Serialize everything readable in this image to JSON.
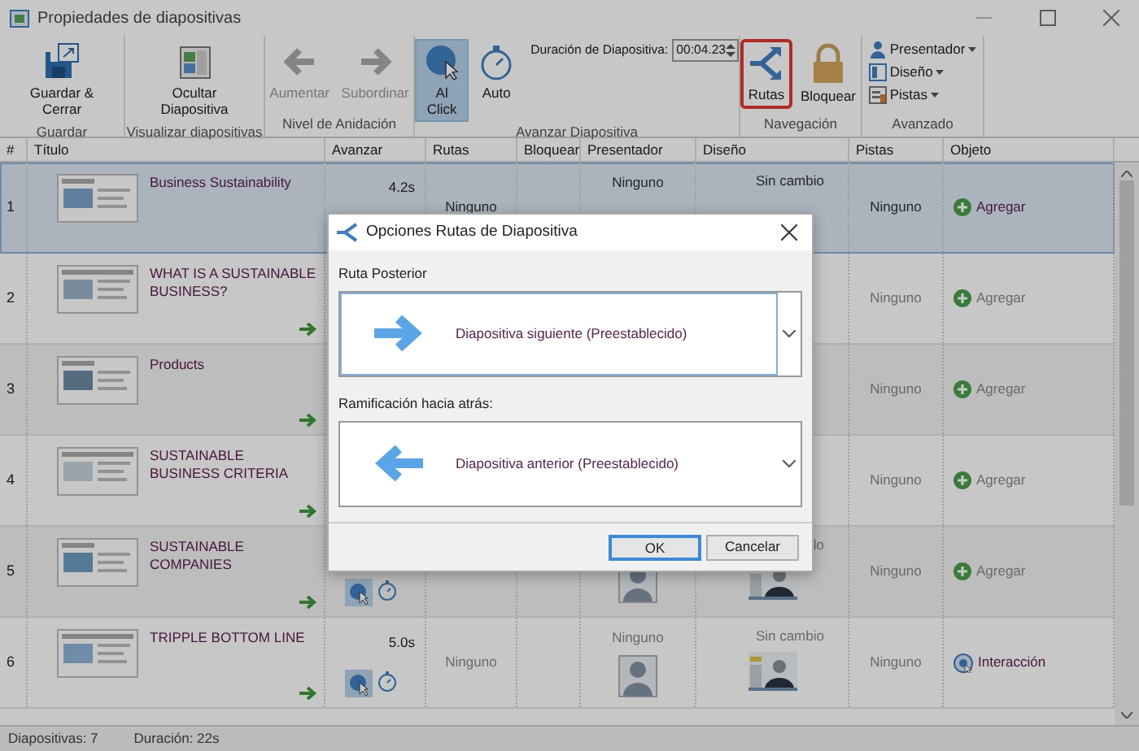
{
  "window": {
    "title": "Propiedades de diapositivas"
  },
  "ribbon": {
    "groups": [
      {
        "label": "Guardar",
        "items": [
          {
            "kind": "button",
            "label": "Guardar & Cerrar",
            "disabled": false,
            "selected": false,
            "highlighted": false
          }
        ]
      },
      {
        "label": "Visualizar diapositivas",
        "items": [
          {
            "kind": "button",
            "label": "Ocultar Diapositiva",
            "disabled": false,
            "selected": false,
            "highlighted": false
          }
        ]
      },
      {
        "label": "Nivel de Anidación",
        "items": [
          {
            "kind": "button",
            "label": "Aumentar",
            "disabled": true,
            "selected": false,
            "highlighted": false
          },
          {
            "kind": "button",
            "label": "Subordinar",
            "disabled": true,
            "selected": false,
            "highlighted": false
          }
        ]
      },
      {
        "label": "Avanzar Diapositiva",
        "items": [
          {
            "kind": "button",
            "label": "Al Click",
            "disabled": false,
            "selected": true,
            "highlighted": false
          },
          {
            "kind": "button",
            "label": "Auto",
            "disabled": false,
            "selected": false,
            "highlighted": false
          },
          {
            "kind": "spin",
            "label": "Duración de Diapositiva:",
            "value": "00:04.23"
          }
        ]
      },
      {
        "label": "Navegación",
        "items": [
          {
            "kind": "button",
            "label": "Rutas",
            "disabled": false,
            "selected": false,
            "highlighted": true
          },
          {
            "kind": "button",
            "label": "Bloquear",
            "disabled": false,
            "selected": false,
            "highlighted": false
          }
        ]
      },
      {
        "label": "Avanzado",
        "items": [
          {
            "kind": "menu",
            "label": "Presentador"
          },
          {
            "kind": "menu",
            "label": "Diseño"
          },
          {
            "kind": "menu",
            "label": "Pistas"
          }
        ]
      }
    ]
  },
  "table": {
    "columns": [
      "#",
      "Título",
      "Avanzar",
      "Rutas",
      "Bloquear",
      "Presentador",
      "Diseño",
      "Pistas",
      "Objeto"
    ],
    "rows": [
      {
        "number": "1",
        "title": "Business Sustainability",
        "selected": true,
        "next_arrow": false,
        "advance_time": "4.2s",
        "routes": "Ninguno",
        "presenter": "Ninguno",
        "design": "Sin cambio",
        "tracks": "Ninguno",
        "object": {
          "kind": "add",
          "label": "Agregar"
        }
      },
      {
        "number": "2",
        "title": "WHAT IS A SUSTAINABLE BUSINESS?",
        "selected": false,
        "next_arrow": true,
        "tracks": "Ninguno",
        "object": {
          "kind": "add",
          "label": "Agregar"
        }
      },
      {
        "number": "3",
        "title": "Products",
        "selected": false,
        "next_arrow": true,
        "tracks": "Ninguno",
        "object": {
          "kind": "add",
          "label": "Agregar"
        }
      },
      {
        "number": "4",
        "title": "SUSTAINABLE BUSINESS CRITERIA",
        "selected": false,
        "next_arrow": true,
        "tracks": "Ninguno",
        "object": {
          "kind": "add",
          "label": "Agregar"
        }
      },
      {
        "number": "5",
        "title": "SUSTAINABLE COMPANIES",
        "selected": false,
        "next_arrow": true,
        "advance_icons": true,
        "presenter_icon": true,
        "design": "lo",
        "design_icon": true,
        "tracks": "Ninguno",
        "object": {
          "kind": "add",
          "label": "Agregar"
        }
      },
      {
        "number": "6",
        "title": "TRIPPLE BOTTOM LINE",
        "selected": false,
        "next_arrow": true,
        "advance_time": "5.0s",
        "advance_icons": true,
        "routes": "Ninguno",
        "presenter": "Ninguno",
        "presenter_icon": true,
        "design": "Sin cambio",
        "design_icon": true,
        "tracks": "Ninguno",
        "object": {
          "kind": "interaction",
          "label": "Interacción"
        }
      }
    ]
  },
  "status_bar": {
    "slides": "Diapositivas: 7",
    "duration": "Duración: 22s"
  },
  "dialog": {
    "title": "Opciones Rutas de Diapositiva",
    "sections": [
      {
        "label": "Ruta Posterior",
        "value": "Diapositiva siguiente (Preestablecido)",
        "focused": true
      },
      {
        "label": "Ramificación hacia atrás:",
        "value": "Diapositiva anterior (Preestablecido)",
        "focused": false
      }
    ],
    "buttons": [
      {
        "label": "OK",
        "default": true
      },
      {
        "label": "Cancelar",
        "default": false
      }
    ]
  }
}
